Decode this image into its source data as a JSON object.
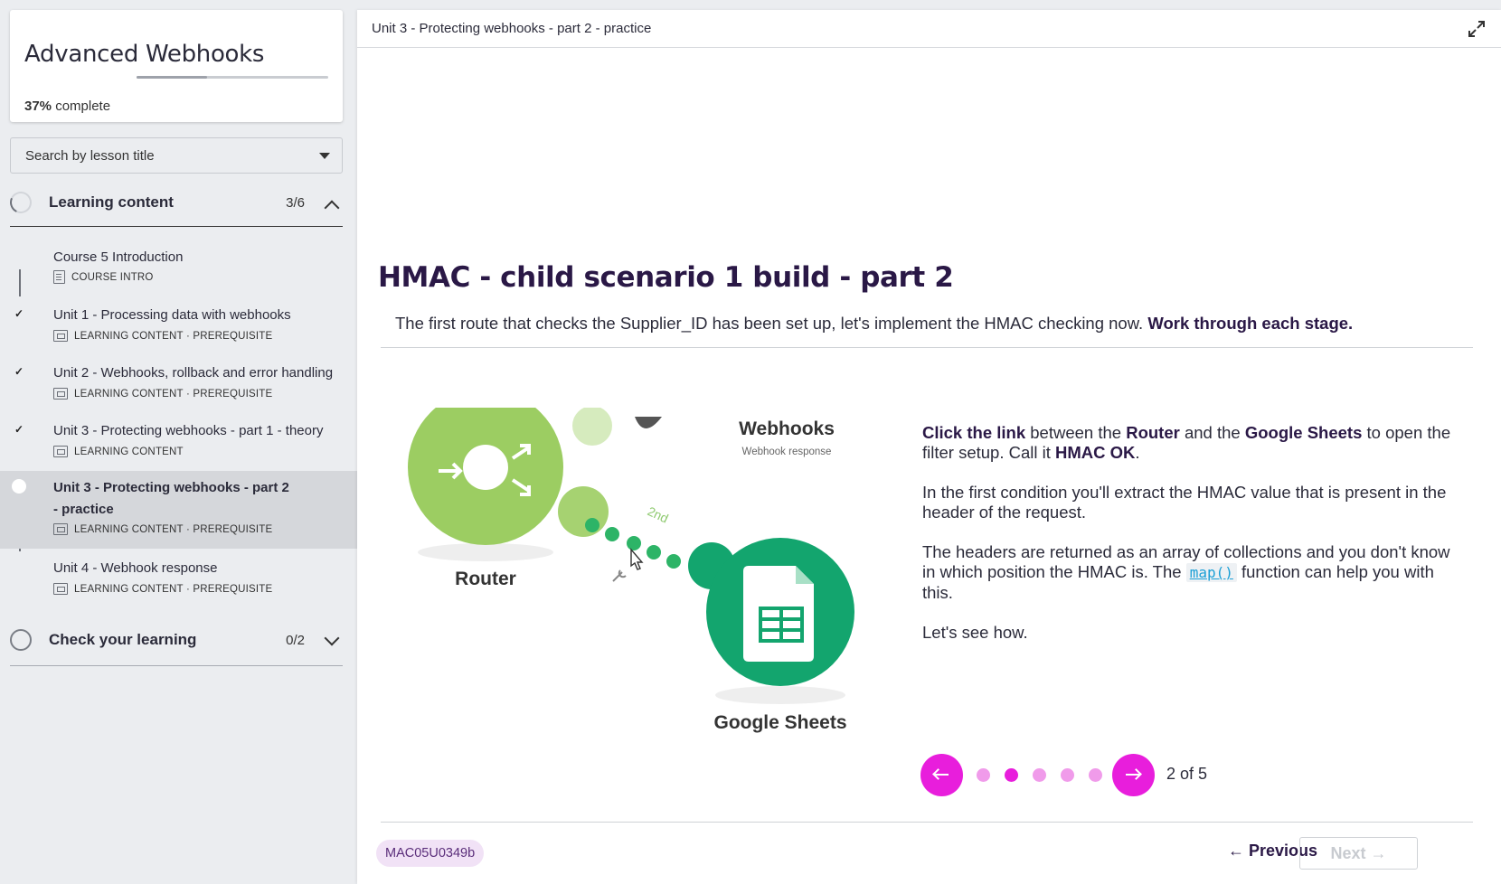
{
  "sidebar": {
    "course_title": "Advanced Webhooks",
    "progress_percent": "37%",
    "progress_suffix": "complete",
    "progress_fraction": 0.37,
    "search_placeholder": "Search by lesson title",
    "sections": [
      {
        "title": "Learning content",
        "count": "3/6",
        "expanded": true
      },
      {
        "title": "Check your learning",
        "count": "0/2",
        "expanded": false
      }
    ],
    "lessons": [
      {
        "name": "Course 5 Introduction",
        "meta": "COURSE INTRO",
        "done": false,
        "active": false
      },
      {
        "name": "Unit 1 - Processing data with webhooks",
        "meta": "LEARNING CONTENT · PREREQUISITE",
        "done": true,
        "active": false
      },
      {
        "name": "Unit 2 - Webhooks, rollback and error handling",
        "meta": "LEARNING CONTENT · PREREQUISITE",
        "done": true,
        "active": false
      },
      {
        "name": "Unit 3 - Protecting webhooks - part 1 - theory",
        "meta": "LEARNING CONTENT",
        "done": true,
        "active": false
      },
      {
        "name": "Unit 3 - Protecting webhooks - part 2 - practice",
        "meta": "LEARNING CONTENT · PREREQUISITE",
        "done": false,
        "active": true
      },
      {
        "name": "Unit 4 - Webhook response",
        "meta": "LEARNING CONTENT · PREREQUISITE",
        "done": false,
        "active": false
      }
    ]
  },
  "main": {
    "breadcrumb": "Unit 3 - Protecting webhooks - part 2 - practice",
    "title": "HMAC - child scenario 1 build - part 2",
    "intro_text": "The first route that checks the Supplier_ID has been set up, let's implement the HMAC checking now. ",
    "intro_bold": "Work through each stage.",
    "illustration": {
      "router_label": "Router",
      "webhooks_label": "Webhooks",
      "webhooks_sub": "Webhook response",
      "route_label": "2nd",
      "sheets_label": "Google Sheets"
    },
    "desc": {
      "p1_a": "Click the link",
      "p1_b": " between the ",
      "p1_c": "Router",
      "p1_d": " and the ",
      "p1_e": "Google Sheets",
      "p1_f": " to open the filter setup. Call it ",
      "p1_g": "HMAC OK",
      "p1_h": ".",
      "p2": "In the first condition you'll extract the HMAC value that is present in the header of the request.",
      "p3_a": "The headers are returned as an array of collections and you don't know in which position the HMAC is. The ",
      "p3_code": "map()",
      "p3_b": " function can help you with this.",
      "p4": "Let's see how."
    },
    "carousel": {
      "current": 2,
      "total": 5,
      "label": "2 of 5"
    },
    "lesson_code": "MAC05U0349b",
    "prev_label": "Previous",
    "next_label": "Next",
    "accent_color": "#e81edc"
  }
}
